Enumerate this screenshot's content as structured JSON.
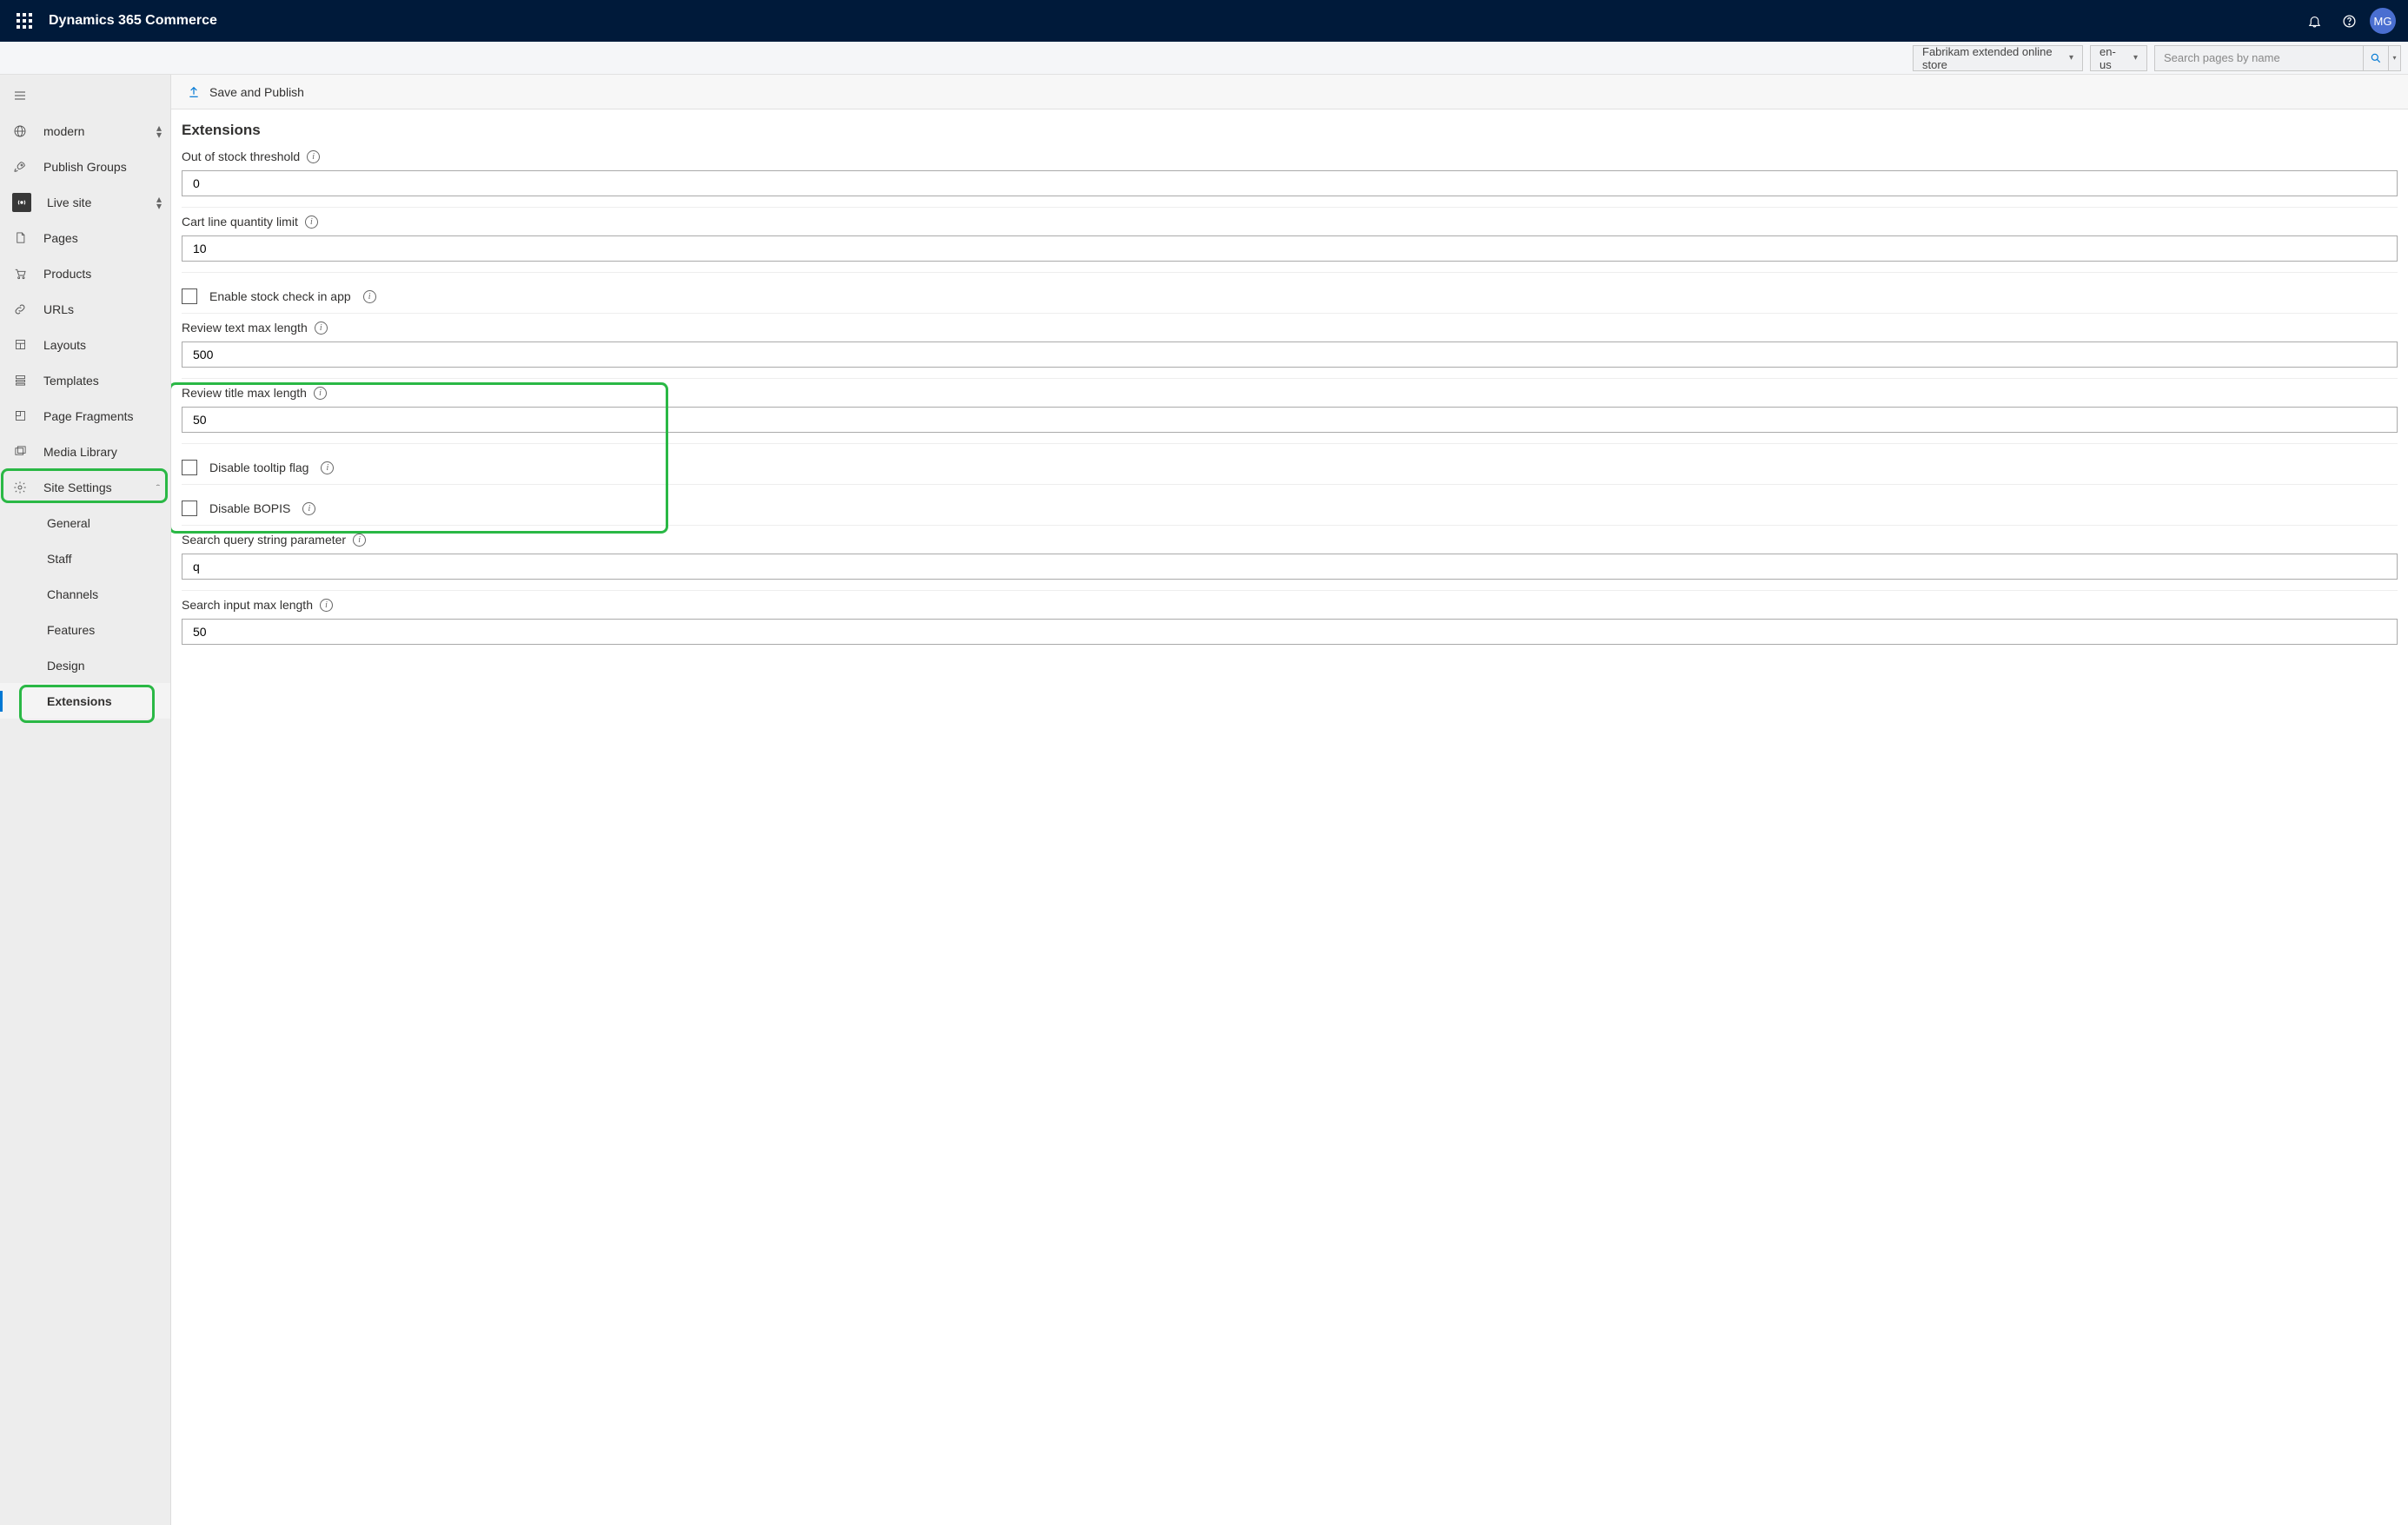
{
  "header": {
    "app_title": "Dynamics 365 Commerce",
    "avatar_initials": "MG"
  },
  "secondary": {
    "site_name": "Fabrikam extended online store",
    "locale": "en-us",
    "search_placeholder": "Search pages by name"
  },
  "sidebar": {
    "items": {
      "modern": "modern",
      "publish_groups": "Publish Groups",
      "live_site": "Live site",
      "pages": "Pages",
      "products": "Products",
      "urls": "URLs",
      "layouts": "Layouts",
      "templates": "Templates",
      "page_fragments": "Page Fragments",
      "media_library": "Media Library",
      "site_settings": "Site Settings"
    },
    "subs": {
      "general": "General",
      "staff": "Staff",
      "channels": "Channels",
      "features": "Features",
      "design": "Design",
      "extensions": "Extensions"
    }
  },
  "command_bar": {
    "save_and_publish": "Save and Publish"
  },
  "page": {
    "title": "Extensions",
    "fields": {
      "out_of_stock_threshold": {
        "label": "Out of stock threshold",
        "value": "0"
      },
      "cart_line_quantity_limit": {
        "label": "Cart line quantity limit",
        "value": "10"
      },
      "enable_stock_check": {
        "label": "Enable stock check in app",
        "checked": false
      },
      "review_text_max_length": {
        "label": "Review text max length",
        "value": "500"
      },
      "review_title_max_length": {
        "label": "Review title max length",
        "value": "50"
      },
      "disable_tooltip_flag": {
        "label": "Disable tooltip flag",
        "checked": false
      },
      "disable_bopis": {
        "label": "Disable BOPIS",
        "checked": false
      },
      "search_query_string_parameter": {
        "label": "Search query string parameter",
        "value": "q"
      },
      "search_input_max_length": {
        "label": "Search input max length",
        "value": "50"
      }
    }
  }
}
